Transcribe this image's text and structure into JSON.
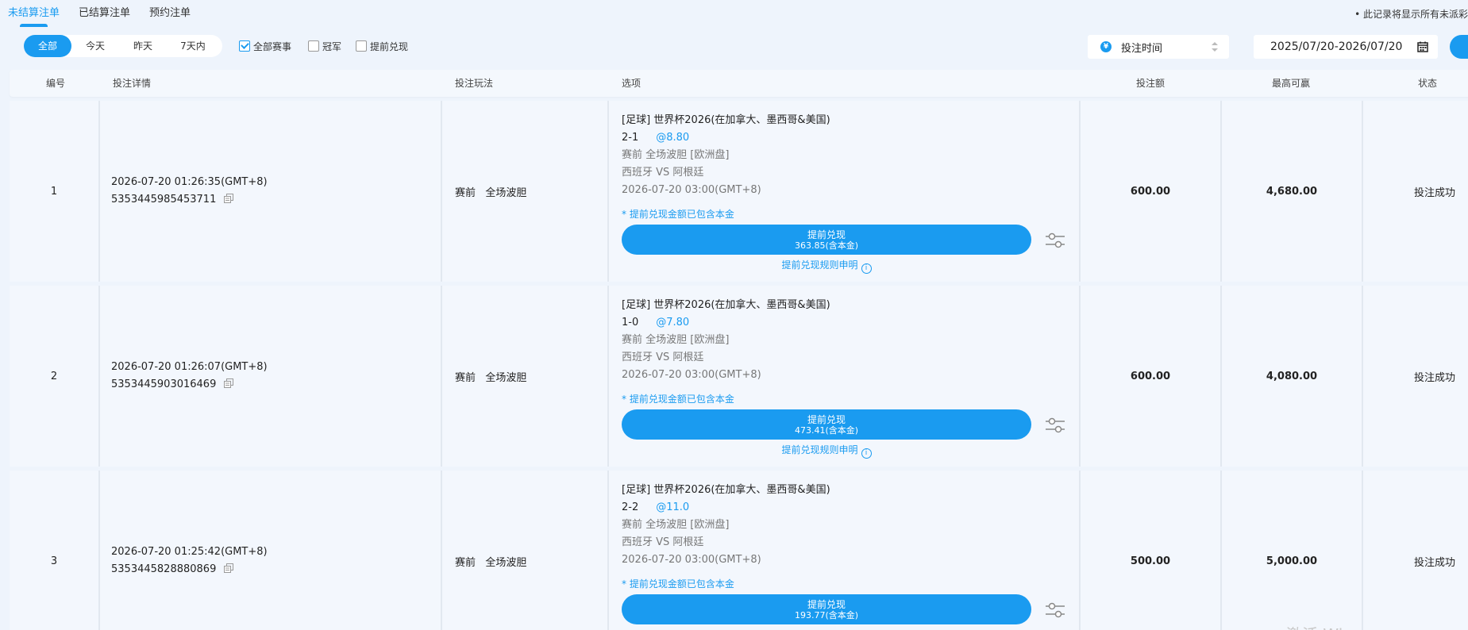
{
  "tabs": [
    {
      "label": "未结算注单",
      "active": true
    },
    {
      "label": "已结算注单",
      "active": false
    },
    {
      "label": "预约注单",
      "active": false
    }
  ],
  "note": "• 此记录将显示所有未派彩",
  "filters": {
    "ranges": [
      {
        "label": "全部",
        "active": true
      },
      {
        "label": "今天",
        "active": false
      },
      {
        "label": "昨天",
        "active": false
      },
      {
        "label": "7天内",
        "active": false
      }
    ],
    "checks": [
      {
        "label": "全部赛事",
        "checked": true
      },
      {
        "label": "冠军",
        "checked": false
      },
      {
        "label": "提前兑现",
        "checked": false
      }
    ],
    "sort_label": "投注时间",
    "date_range": "2025/07/20-2026/07/20"
  },
  "columns": [
    "编号",
    "投注详情",
    "投注玩法",
    "选项",
    "投注额",
    "最高可赢",
    "状态"
  ],
  "rows": [
    {
      "no": "1",
      "time": "2026-07-20 01:26:35(GMT+8)",
      "id": "5353445985453711",
      "play": "赛前   全场波胆",
      "league": "[足球] 世界杯2026(在加拿大、墨西哥&美国)",
      "score": "2-1",
      "odds": "@8.80",
      "market": "赛前 全场波胆 [欧洲盘]",
      "match": "西班牙 VS 阿根廷",
      "match_time": "2026-07-20 03:00(GMT+8)",
      "tip": "* 提前兑现金额已包含本金",
      "cashout_label": "提前兑现",
      "cashout_amount": "363.85(含本金)",
      "rule": "提前兑现规则申明",
      "stake": "600.00",
      "max_win": "4,680.00",
      "status": "投注成功"
    },
    {
      "no": "2",
      "time": "2026-07-20 01:26:07(GMT+8)",
      "id": "5353445903016469",
      "play": "赛前   全场波胆",
      "league": "[足球] 世界杯2026(在加拿大、墨西哥&美国)",
      "score": "1-0",
      "odds": "@7.80",
      "market": "赛前 全场波胆 [欧洲盘]",
      "match": "西班牙 VS 阿根廷",
      "match_time": "2026-07-20 03:00(GMT+8)",
      "tip": "* 提前兑现金额已包含本金",
      "cashout_label": "提前兑现",
      "cashout_amount": "473.41(含本金)",
      "rule": "提前兑现规则申明",
      "stake": "600.00",
      "max_win": "4,080.00",
      "status": "投注成功"
    },
    {
      "no": "3",
      "time": "2026-07-20 01:25:42(GMT+8)",
      "id": "5353445828880869",
      "play": "赛前   全场波胆",
      "league": "[足球] 世界杯2026(在加拿大、墨西哥&美国)",
      "score": "2-2",
      "odds": "@11.0",
      "market": "赛前 全场波胆 [欧洲盘]",
      "match": "西班牙 VS 阿根廷",
      "match_time": "2026-07-20 03:00(GMT+8)",
      "tip": "* 提前兑现金额已包含本金",
      "cashout_label": "提前兑现",
      "cashout_amount": "193.77(含本金)",
      "rule": "",
      "stake": "500.00",
      "max_win": "5,000.00",
      "status": "投注成功"
    }
  ],
  "watermark": "激活 Wi"
}
